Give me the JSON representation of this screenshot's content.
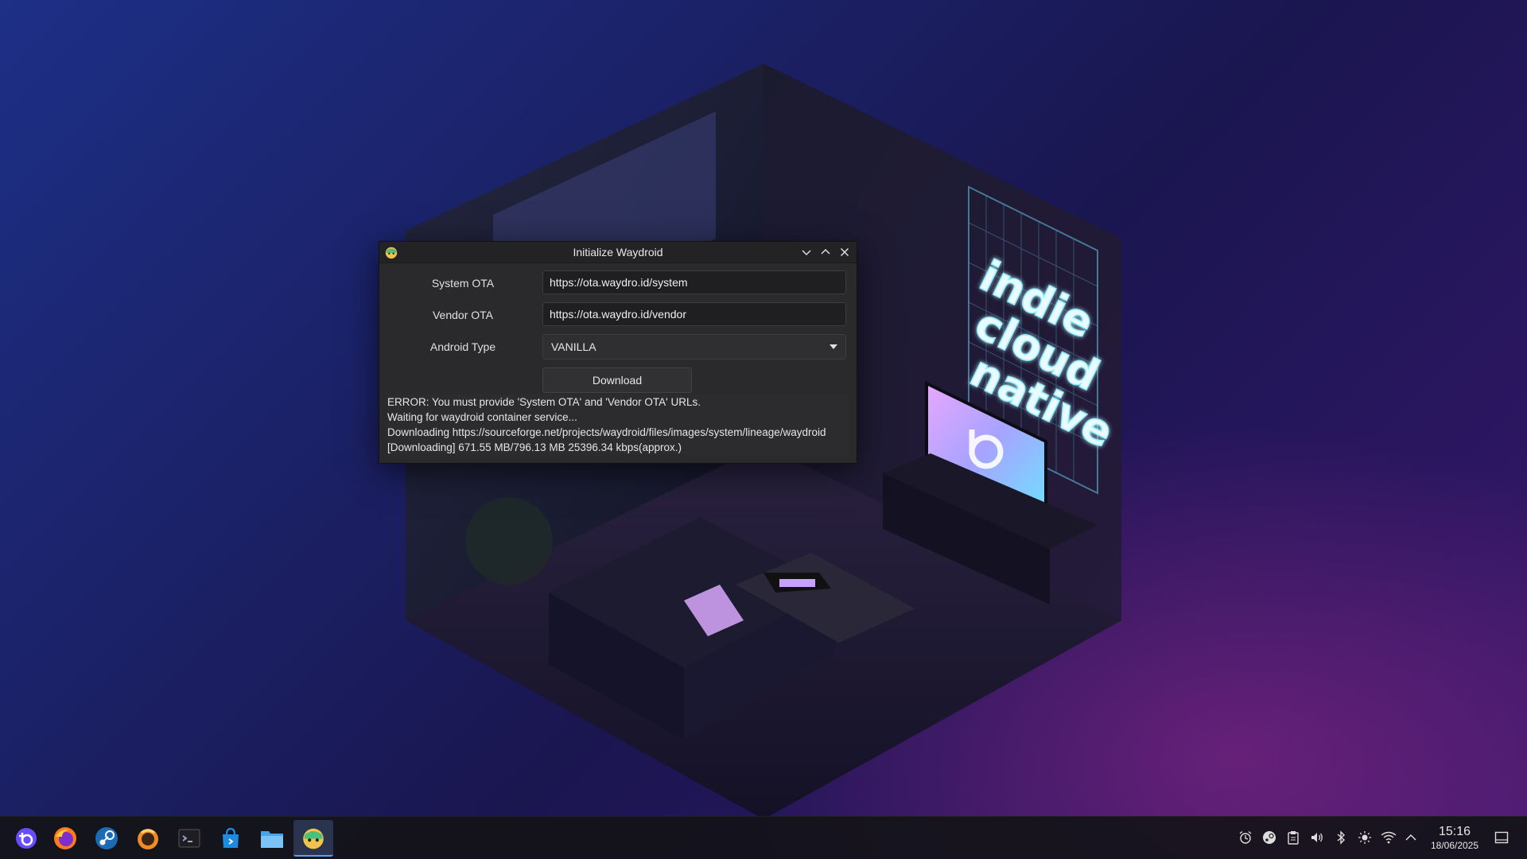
{
  "window": {
    "title": "Initialize Waydroid",
    "icon": "waydroid-icon"
  },
  "form": {
    "system_ota_label": "System OTA",
    "system_ota_value": "https://ota.waydro.id/system",
    "vendor_ota_label": "Vendor OTA",
    "vendor_ota_value": "https://ota.waydro.id/vendor",
    "android_type_label": "Android Type",
    "android_type_value": "VANILLA",
    "download_label": "Download"
  },
  "log": {
    "lines": [
      "ERROR: You must provide 'System OTA' and 'Vendor OTA' URLs.",
      "Waiting for waydroid container service...",
      "Downloading https://sourceforge.net/projects/waydroid/files/images/system/lineage/waydroid",
      "[Downloading] 671.55 MB/796.13 MB    25396.34 kbps(approx.)"
    ]
  },
  "wallpaper": {
    "neon_sign": [
      "indie",
      "cloud",
      "native"
    ]
  },
  "taskbar": {
    "apps": [
      {
        "name": "launcher-icon"
      },
      {
        "name": "firefox-icon"
      },
      {
        "name": "steam-icon"
      },
      {
        "name": "bazzite-portal-icon"
      },
      {
        "name": "terminal-icon"
      },
      {
        "name": "store-icon"
      },
      {
        "name": "file-manager-icon"
      },
      {
        "name": "waydroid-icon",
        "active": true
      }
    ],
    "tray": [
      "alarm-icon",
      "steam-tray-icon",
      "clipboard-icon",
      "volume-icon",
      "bluetooth-icon",
      "brightness-icon",
      "wifi-icon",
      "expand-tray-icon"
    ],
    "clock_time": "15:16",
    "clock_date": "18/06/2025"
  },
  "colors": {
    "accent": "#5aa0ff",
    "window_bg": "#2a2a2c",
    "neon": "#8ff0ff"
  }
}
